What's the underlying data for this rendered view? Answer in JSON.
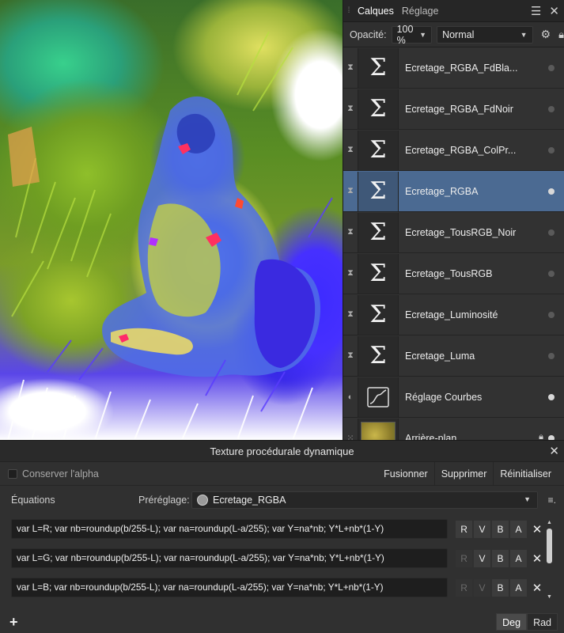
{
  "layers_panel": {
    "tabs": [
      {
        "label": "Calques",
        "active": true
      },
      {
        "label": "Réglage",
        "active": false
      }
    ],
    "opacity_label": "Opacité:",
    "opacity_value": "100 %",
    "blend_mode": "Normal",
    "layers": [
      {
        "name": "Ecretage_RGBA_FdBla...",
        "icon": "sigma-icon",
        "selected": false,
        "visible": false,
        "locked": false
      },
      {
        "name": "Ecretage_RGBA_FdNoir",
        "icon": "sigma-icon",
        "selected": false,
        "visible": false,
        "locked": false
      },
      {
        "name": "Ecretage_RGBA_ColPr...",
        "icon": "sigma-icon",
        "selected": false,
        "visible": false,
        "locked": false
      },
      {
        "name": "Ecretage_RGBA",
        "icon": "sigma-icon",
        "selected": true,
        "visible": true,
        "locked": false
      },
      {
        "name": "Ecretage_TousRGB_Noir",
        "icon": "sigma-icon",
        "selected": false,
        "visible": false,
        "locked": false
      },
      {
        "name": "Ecretage_TousRGB",
        "icon": "sigma-icon",
        "selected": false,
        "visible": false,
        "locked": false
      },
      {
        "name": "Ecretage_Luminosité",
        "icon": "sigma-icon",
        "selected": false,
        "visible": false,
        "locked": false
      },
      {
        "name": "Ecretage_Luma",
        "icon": "sigma-icon",
        "selected": false,
        "visible": false,
        "locked": false
      },
      {
        "name": "Réglage Courbes",
        "icon": "curves-icon",
        "selected": false,
        "visible": true,
        "locked": false
      },
      {
        "name": "Arrière-plan",
        "icon": "photo-thumbnail",
        "selected": false,
        "visible": true,
        "locked": true
      }
    ]
  },
  "dialog": {
    "title": "Texture procédurale dynamique",
    "preserve_alpha_label": "Conserver l'alpha",
    "buttons": {
      "merge": "Fusionner",
      "delete": "Supprimer",
      "reset": "Réinitialiser"
    },
    "equations_label": "Équations",
    "preset_label": "Préréglage:",
    "preset_value": "Ecretage_RGBA",
    "equations": [
      {
        "text": "var L=R; var nb=roundup(b/255-L); var na=roundup(L-a/255); var Y=na*nb; Y*L+nb*(1-Y)",
        "channels": {
          "R": true,
          "V": true,
          "B": true,
          "A": true
        }
      },
      {
        "text": "var L=G; var nb=roundup(b/255-L); var na=roundup(L-a/255); var Y=na*nb; Y*L+nb*(1-Y)",
        "channels": {
          "R": false,
          "V": true,
          "B": true,
          "A": true
        }
      },
      {
        "text": "var L=B; var nb=roundup(b/255-L); var na=roundup(L-a/255); var Y=na*nb; Y*L+nb*(1-Y)",
        "channels": {
          "R": false,
          "V": false,
          "B": true,
          "A": true
        }
      }
    ],
    "channel_labels": [
      "R",
      "V",
      "B",
      "A"
    ],
    "units": [
      {
        "label": "Deg",
        "active": true
      },
      {
        "label": "Rad",
        "active": false
      }
    ]
  }
}
